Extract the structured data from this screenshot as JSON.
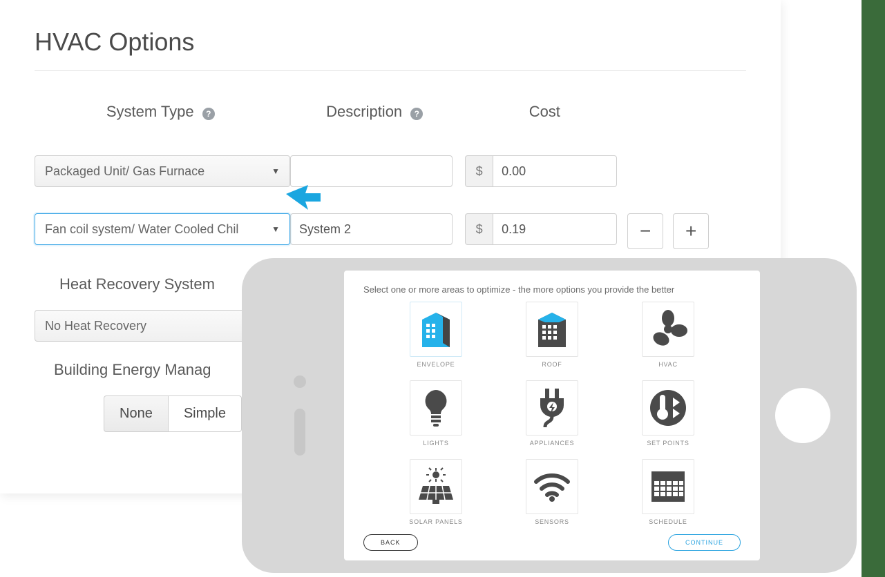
{
  "page": {
    "title": "HVAC Options"
  },
  "labels": {
    "system_type": "System Type",
    "description": "Description",
    "cost": "Cost",
    "heat_recovery": "Heat Recovery System",
    "bem": "Building Energy Manag"
  },
  "rows": [
    {
      "system": "Packaged Unit/ Gas Furnace",
      "description": "",
      "cost": "0.00"
    },
    {
      "system": "Fan coil system/ Water Cooled Chil",
      "description": "System 2",
      "cost": "0.19"
    }
  ],
  "cost_prefix": "$",
  "heat_recovery_value": "No Heat Recovery",
  "bem_options": [
    "None",
    "Simple"
  ],
  "bem_selected": "None",
  "steppers": {
    "minus": "−",
    "plus": "+"
  },
  "overlay": {
    "instructions": "Select one or more areas to optimize - the more options you provide the better",
    "tiles": [
      {
        "caption": "ENVELOPE",
        "icon": "building-envelope",
        "selected": true
      },
      {
        "caption": "ROOF",
        "icon": "building-roof",
        "selected": false
      },
      {
        "caption": "HVAC",
        "icon": "fan",
        "selected": false
      },
      {
        "caption": "LIGHTS",
        "icon": "lightbulb",
        "selected": false
      },
      {
        "caption": "APPLIANCES",
        "icon": "plug",
        "selected": false
      },
      {
        "caption": "SET POINTS",
        "icon": "thermostat",
        "selected": false
      },
      {
        "caption": "SOLAR PANELS",
        "icon": "solar-panel",
        "selected": false
      },
      {
        "caption": "SENSORS",
        "icon": "wifi",
        "selected": false
      },
      {
        "caption": "SCHEDULE",
        "icon": "calendar",
        "selected": false
      }
    ],
    "back": "BACK",
    "continue": "CONTINUE"
  }
}
